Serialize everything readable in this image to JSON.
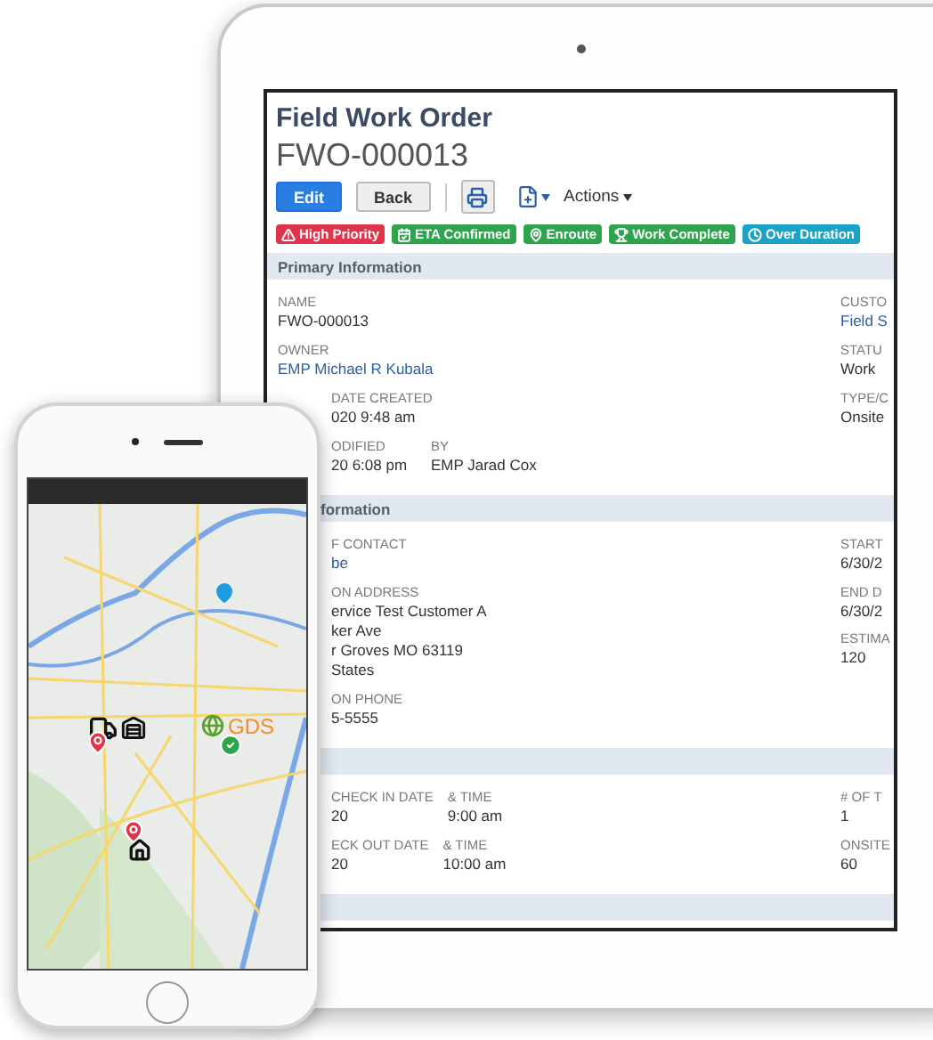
{
  "tablet": {
    "title": "Field Work Order",
    "record_id": "FWO-000013",
    "toolbar": {
      "edit": "Edit",
      "back": "Back",
      "actions": "Actions"
    },
    "badges": [
      {
        "label": "High Priority",
        "kind": "warning",
        "color": "#e0344a"
      },
      {
        "label": "ETA Confirmed",
        "kind": "calendar",
        "color": "#2ea44f"
      },
      {
        "label": "Enroute",
        "kind": "pin",
        "color": "#2ea44f"
      },
      {
        "label": "Work Complete",
        "kind": "trophy",
        "color": "#2ea44f"
      },
      {
        "label": "Over Duration",
        "kind": "clock",
        "color": "#1ba3c6"
      }
    ],
    "sections": [
      {
        "title": "Primary Information",
        "rows": [
          {
            "fields": [
              {
                "label": "NAME",
                "value": "FWO-000013",
                "link": false
              }
            ],
            "side": {
              "label": "CUSTO",
              "value": "Field S",
              "link": true
            }
          },
          {
            "fields": [
              {
                "label": "OWNER",
                "value": "EMP Michael R Kubala",
                "link": true
              }
            ],
            "side": {
              "label": "STATU",
              "value": "Work",
              "link": false
            }
          },
          {
            "fields": [
              {
                "label": "DATE CREATED",
                "value": "020 9:48 am",
                "link": false
              }
            ],
            "side": {
              "label": "TYPE/C",
              "value": "Onsite",
              "link": false
            }
          },
          {
            "fields": [
              {
                "label": "ODIFIED",
                "value": "20 6:08 pm",
                "link": false
              },
              {
                "label": "BY",
                "value": "EMP Jarad Cox",
                "link": false
              }
            ]
          }
        ]
      },
      {
        "title": "formation",
        "rows": [
          {
            "fields": [
              {
                "label": "F CONTACT",
                "value": "be",
                "link": true
              }
            ],
            "side": {
              "label": "START",
              "value": "6/30/2",
              "link": false
            }
          },
          {
            "fields": [
              {
                "label": "ON ADDRESS",
                "lines": [
                  "ervice Test Customer A",
                  "ker Ave",
                  "r Groves MO 63119",
                  "States"
                ],
                "link": false
              }
            ],
            "side": {
              "label": "END D",
              "value": "6/30/2",
              "link": false
            },
            "side2": {
              "label": "ESTIMA",
              "value": "120",
              "link": false
            }
          },
          {
            "fields": [
              {
                "label": "ON PHONE",
                "value": "5-5555",
                "link": false
              }
            ]
          }
        ]
      },
      {
        "rows": [
          {
            "fields": [
              {
                "label": "CHECK IN DATE",
                "value": "20",
                "link": false
              },
              {
                "label": "& TIME",
                "value": "9:00 am",
                "link": false
              }
            ],
            "side": {
              "label": "# OF T",
              "value": "1",
              "link": false
            }
          },
          {
            "fields": [
              {
                "label": "ECK OUT DATE",
                "value": "20",
                "link": false
              },
              {
                "label": "& TIME",
                "value": "10:00 am",
                "link": false
              }
            ],
            "side": {
              "label": "ONSITE",
              "value": "60",
              "link": false
            }
          }
        ]
      }
    ]
  },
  "phone": {
    "map_logo": "GDS"
  }
}
